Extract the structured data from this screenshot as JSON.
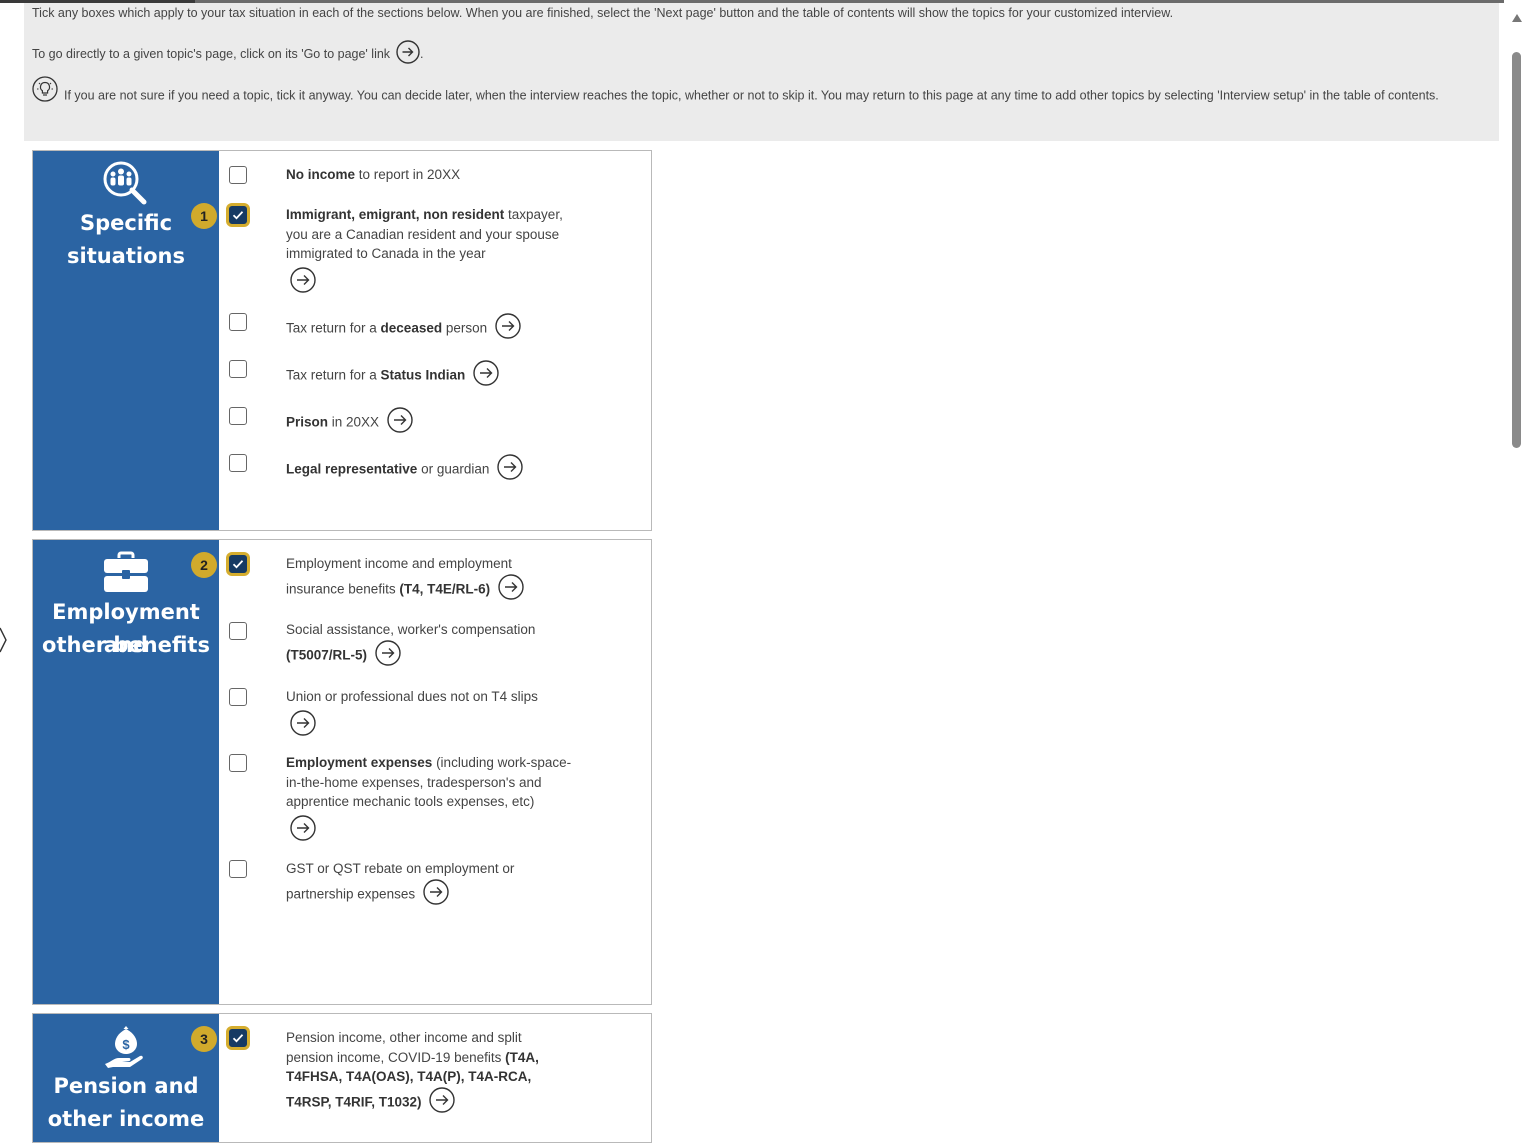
{
  "intro": {
    "line1": "Tick any boxes  which apply to your tax situation in each of the sections below. When you are finished, select the 'Next page' button and the table of contents will show the topics for your customized interview.",
    "line2": "To go directly to a given topic's page, click on its 'Go to page' link",
    "line2_end": ".",
    "line3": "If you are not sure if you need a topic, tick it anyway. You can decide later, when the interview reaches the topic, whether or not to skip it. You may return to this page at any time to add other topics by selecting 'Interview setup' in the table of contents."
  },
  "sections": {
    "specific": {
      "icon": "people-search-icon",
      "title_line1": "Specific",
      "title_line2": "situations",
      "badge": "1",
      "items": {
        "no_income": {
          "b1": "No income",
          "t1": " to report in 20XX",
          "checked": false
        },
        "immigrant": {
          "b1": "Immigrant, emigrant, non resident",
          "t1": " taxpayer, you are a Canadian resident and your spouse immigrated to Canada in the year",
          "checked": true
        },
        "deceased": {
          "t1": "Tax return for a ",
          "b1": "deceased",
          "t2": " person",
          "checked": false
        },
        "status_indian": {
          "t1": "Tax return for a ",
          "b1": "Status Indian",
          "checked": false
        },
        "prison": {
          "b1": "Prison",
          "t1": " in 20XX",
          "checked": false
        },
        "legal_rep": {
          "b1": "Legal representative",
          "t1": " or guardian",
          "checked": false
        }
      }
    },
    "employment": {
      "icon": "briefcase-icon",
      "title_line1": "Employment and",
      "title_line2": "other benefits",
      "badge": "2",
      "items": {
        "employment_income": {
          "t1": "Employment income and employment insurance benefits ",
          "b1": "(T4, T4E/RL-6)",
          "checked": true
        },
        "social_assistance": {
          "t1": "Social assistance, worker's compensation ",
          "b1": "(T5007/RL-5)",
          "checked": false
        },
        "union_dues": {
          "t1": "Union or professional dues not on T4 slips",
          "checked": false
        },
        "employment_expenses": {
          "b1": "Employment expenses",
          "t1": " (including work-space-in-the-home expenses, tradesperson's and apprentice mechanic tools expenses, etc)",
          "checked": false
        },
        "gst_rebate": {
          "t1": "GST or QST rebate on employment or partnership expenses",
          "checked": false
        }
      }
    },
    "pension": {
      "icon": "money-hand-icon",
      "title_line1": "Pension and",
      "title_line2": "other income",
      "badge": "3",
      "items": {
        "pension_income": {
          "t1": "Pension income, other income and split pension income, COVID-19 benefits ",
          "b1": "(T4A, T4FHSA, T4A(OAS), T4A(P), T4A-RCA, T4RSP, T4RIF, T1032)",
          "checked": true
        }
      }
    }
  },
  "icons": {
    "go_to_page": "circle-arrow-right-icon",
    "tip": "lightbulb-icon",
    "checkmark": "checkmark-icon"
  },
  "colors": {
    "section_side": "#2b64a3",
    "badge": "#d1aa2c",
    "checked_box": "#163a63",
    "intro_bg": "#ebebeb"
  }
}
